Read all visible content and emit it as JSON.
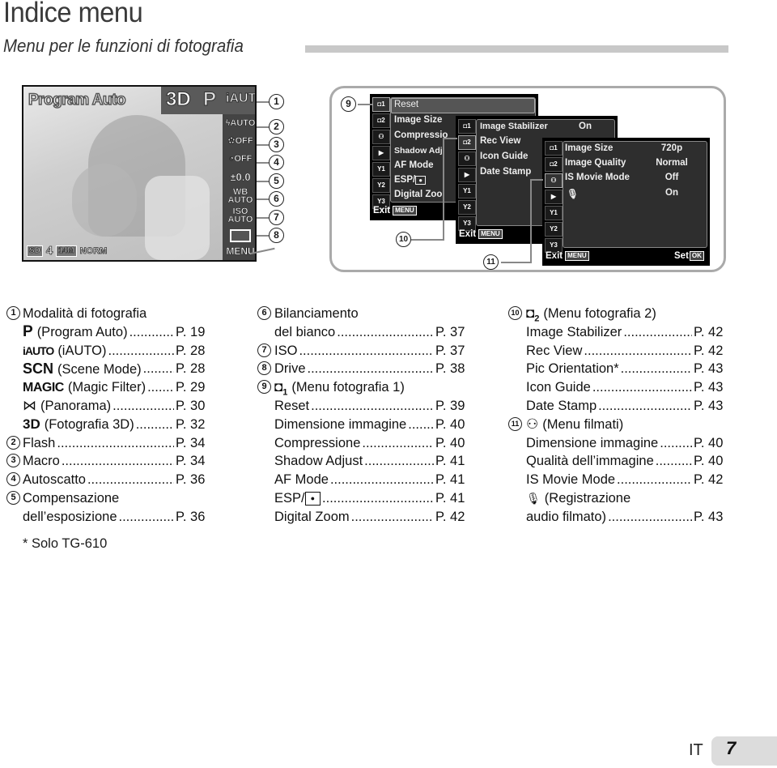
{
  "page": {
    "title": "Indice menu",
    "subtitle": "Menu per le funzioni di fotografia",
    "footnote": "* Solo TG-610",
    "language": "IT",
    "page_number": "7"
  },
  "camera_screen": {
    "mode_title": "Program Auto",
    "modes": [
      "3D",
      "P",
      "iAUTO"
    ],
    "side_icons": [
      {
        "num": "1",
        "label": "iAUTO",
        "icon": "iauto-icon"
      },
      {
        "num": "2",
        "label": "AUTO",
        "icon": "flash-auto-icon"
      },
      {
        "num": "3",
        "label": "OFF",
        "icon": "macro-off-icon"
      },
      {
        "num": "4",
        "label": "OFF",
        "icon": "self-timer-off-icon"
      },
      {
        "num": "5",
        "label": "±0.0",
        "icon": "exposure-icon"
      },
      {
        "num": "6",
        "label_top": "WB",
        "label": "AUTO",
        "icon": "white-balance-icon"
      },
      {
        "num": "7",
        "label_top": "ISO",
        "label": "AUTO",
        "icon": "iso-icon"
      },
      {
        "num": "8",
        "label": "",
        "icon": "drive-single-icon"
      },
      {
        "num": "",
        "label": "MENU",
        "icon": "menu-icon"
      }
    ],
    "status": {
      "card": "SD",
      "remaining": "4",
      "size": "14M",
      "quality": "NORM"
    }
  },
  "menus": {
    "tab_labels": [
      "1",
      "2",
      "movie",
      "play",
      "Y1",
      "Y2",
      "Y3"
    ],
    "menu1": {
      "callout": "9",
      "items": [
        "Reset",
        "Image Size",
        "Compressio",
        "Shadow Adj",
        "AF Mode",
        "ESP/",
        "Digital Zoo"
      ],
      "exit_label": "Exit",
      "exit_key": "MENU"
    },
    "menu2": {
      "callout": "10",
      "items": [
        {
          "label": "Image Stabilizer",
          "value": "On"
        },
        {
          "label": "Rec View",
          "value": ""
        },
        {
          "label": "Icon Guide",
          "value": ""
        },
        {
          "label": "Date Stamp",
          "value": ""
        }
      ],
      "exit_label": "Exit",
      "exit_key": "MENU"
    },
    "menu3": {
      "callout": "11",
      "items": [
        {
          "label": "Image Size",
          "value": "720p"
        },
        {
          "label": "Image Quality",
          "value": "Normal"
        },
        {
          "label": "IS Movie Mode",
          "value": "Off"
        },
        {
          "label": "",
          "value": "On",
          "icon": "microphone-icon"
        }
      ],
      "exit_label": "Exit",
      "exit_key": "MENU",
      "set_label": "Set",
      "set_key": "OK"
    }
  },
  "index": {
    "col1": [
      {
        "num": "1",
        "text": "Modalità di fotografia",
        "page": ""
      },
      {
        "num": "",
        "icon": "P",
        "text": "(Program Auto)",
        "page": "P. 19"
      },
      {
        "num": "",
        "icon": "iAUTO",
        "text": "(iAUTO)",
        "page": "P. 28"
      },
      {
        "num": "",
        "icon": "SCN",
        "text": "(Scene Mode)",
        "page": "P. 28"
      },
      {
        "num": "",
        "icon": "MAGIC",
        "text": "(Magic Filter)",
        "page": "P. 29"
      },
      {
        "num": "",
        "icon": "⋈",
        "text": "(Panorama)",
        "page": "P. 30"
      },
      {
        "num": "",
        "icon": "3D",
        "text": "(Fotografia 3D)",
        "page": "P. 32"
      },
      {
        "num": "2",
        "text": "Flash",
        "page": "P. 34"
      },
      {
        "num": "3",
        "text": "Macro",
        "page": "P. 34"
      },
      {
        "num": "4",
        "text": "Autoscatto",
        "page": "P. 36"
      },
      {
        "num": "5",
        "text": "Compensazione",
        "page": ""
      },
      {
        "num": "",
        "text": "dell’esposizione",
        "page": "P. 36"
      }
    ],
    "col2": [
      {
        "num": "6",
        "text": "Bilanciamento",
        "page": ""
      },
      {
        "num": "",
        "text": "del bianco",
        "page": "P. 37"
      },
      {
        "num": "7",
        "text": "ISO",
        "page": "P. 37"
      },
      {
        "num": "8",
        "text": "Drive",
        "page": "P. 38"
      },
      {
        "num": "9",
        "icon": "camera1",
        "text": "(Menu fotografia 1)",
        "page": ""
      },
      {
        "num": "",
        "text": "Reset",
        "page": "P. 39"
      },
      {
        "num": "",
        "text": "Dimensione immagine",
        "page": "P. 40"
      },
      {
        "num": "",
        "text": "Compressione",
        "page": "P. 40"
      },
      {
        "num": "",
        "text": "Shadow Adjust",
        "page": "P. 41"
      },
      {
        "num": "",
        "text": "AF Mode",
        "page": "P. 41"
      },
      {
        "num": "",
        "text": "ESP/",
        "icon_after": "spot",
        "page": "P. 41"
      },
      {
        "num": "",
        "text": "Digital Zoom",
        "page": "P. 42"
      }
    ],
    "col3": [
      {
        "num": "10",
        "icon": "camera2",
        "text": "(Menu fotografia 2)",
        "page": ""
      },
      {
        "num": "",
        "text": "Image Stabilizer",
        "page": "P. 42"
      },
      {
        "num": "",
        "text": "Rec View",
        "page": "P. 42"
      },
      {
        "num": "",
        "text": "Pic Orientation*",
        "page": "P. 43"
      },
      {
        "num": "",
        "text": "Icon Guide",
        "page": "P. 43"
      },
      {
        "num": "",
        "text": "Date Stamp",
        "page": "P. 43"
      },
      {
        "num": "11",
        "icon": "movie",
        "text": "(Menu filmati)",
        "page": ""
      },
      {
        "num": "",
        "text": "Dimensione immagine",
        "page": "P. 40"
      },
      {
        "num": "",
        "text": "Qualità dell’immagine",
        "page": "P. 40"
      },
      {
        "num": "",
        "text": "IS Movie Mode",
        "page": "P. 42"
      },
      {
        "num": "",
        "icon": "mic",
        "text": "(Registrazione",
        "page": ""
      },
      {
        "num": "",
        "text": "audio filmato)",
        "page": "P. 43"
      }
    ]
  }
}
